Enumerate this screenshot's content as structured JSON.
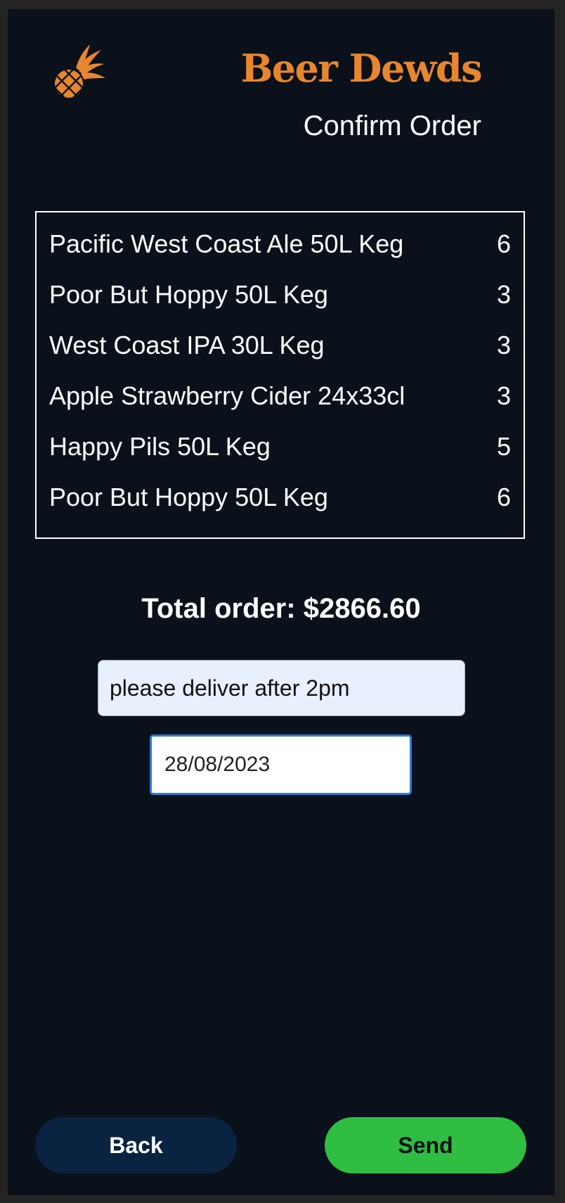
{
  "header": {
    "brand": "Beer Dewds",
    "subtitle": "Confirm Order",
    "logo_icon": "pineapple-icon",
    "brand_color": "#e8862e"
  },
  "order": {
    "items": [
      {
        "name": "Pacific West Coast Ale 50L Keg",
        "qty": "6"
      },
      {
        "name": "Poor But Hoppy 50L Keg",
        "qty": "3"
      },
      {
        "name": "West Coast IPA 30L Keg",
        "qty": "3"
      },
      {
        "name": "Apple Strawberry Cider 24x33cl",
        "qty": "3"
      },
      {
        "name": "Happy Pils 50L Keg",
        "qty": "5"
      },
      {
        "name": "Poor But Hoppy 50L Keg",
        "qty": "6"
      }
    ],
    "total_label": "Total order: $2866.60"
  },
  "form": {
    "notes_value": "please deliver after 2pm",
    "date_value": "28/08/2023"
  },
  "actions": {
    "back_label": "Back",
    "send_label": "Send",
    "back_color": "#0a2340",
    "send_color": "#2fbe41"
  }
}
